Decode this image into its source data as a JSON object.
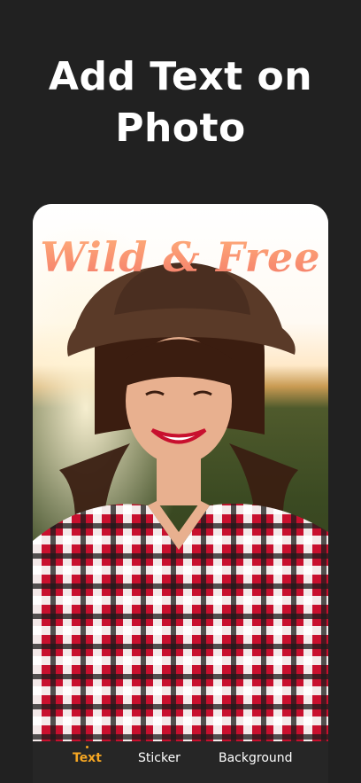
{
  "headline": {
    "line1": "Add Text on",
    "line2": "Photo"
  },
  "photo": {
    "overlay_text": "Wild & Free",
    "overlay_color": "#f58a6c"
  },
  "tabs": [
    {
      "label": "Text",
      "active": true
    },
    {
      "label": "Sticker",
      "active": false
    },
    {
      "label": "Background",
      "active": false
    }
  ],
  "colors": {
    "background": "#212121",
    "accent": "#f5a623",
    "tabbar": "#262626"
  }
}
